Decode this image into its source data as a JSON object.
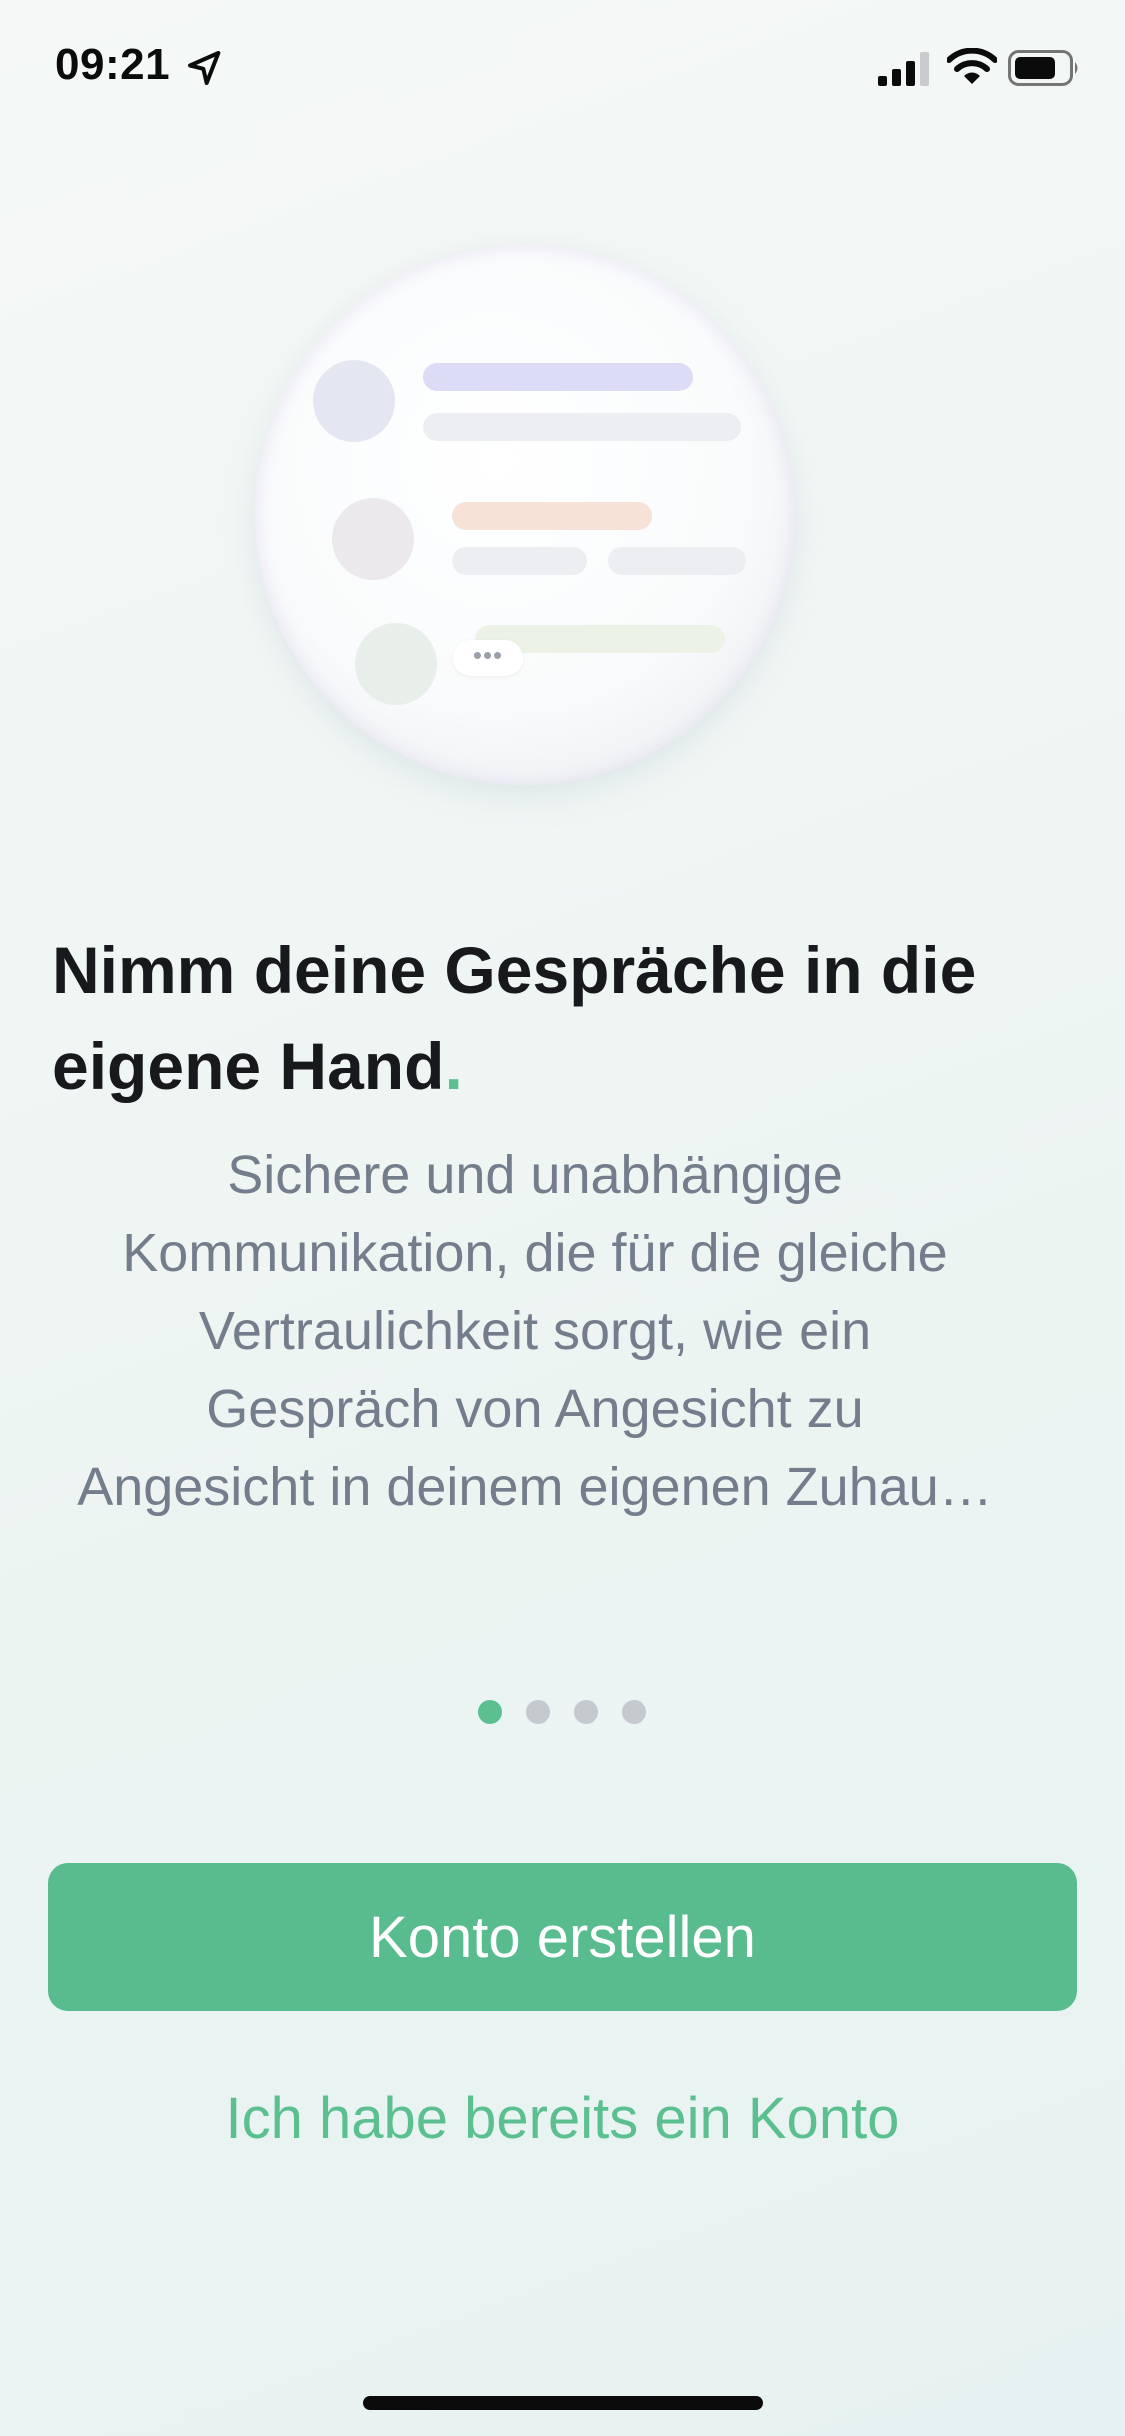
{
  "status_bar": {
    "time": "09:21",
    "icons": [
      "location-arrow-icon",
      "cellular-signal-icon",
      "wifi-icon",
      "battery-icon"
    ]
  },
  "illustration": {
    "typing_indicator": "•••"
  },
  "onboarding": {
    "headline": "Nimm deine Gespräche in die eigene Hand",
    "headline_dot": ".",
    "description_lines": [
      "Sichere und unabhängige",
      "Kommunikation, die für die gleiche",
      "Vertraulichkeit sorgt, wie ein",
      "Gespräch von Angesicht zu",
      "Angesicht in deinem eigenen Zuhau…"
    ],
    "pager": {
      "total_pages": 4,
      "current_page": 1
    }
  },
  "actions": {
    "create_account_label": "Konto erstellen",
    "existing_account_label": "Ich habe bereits ein Konto"
  },
  "colors": {
    "accent": "#5bbf8f",
    "button": "#59bc8f",
    "body_text": "#737d8c",
    "heading_text": "#17191c"
  }
}
